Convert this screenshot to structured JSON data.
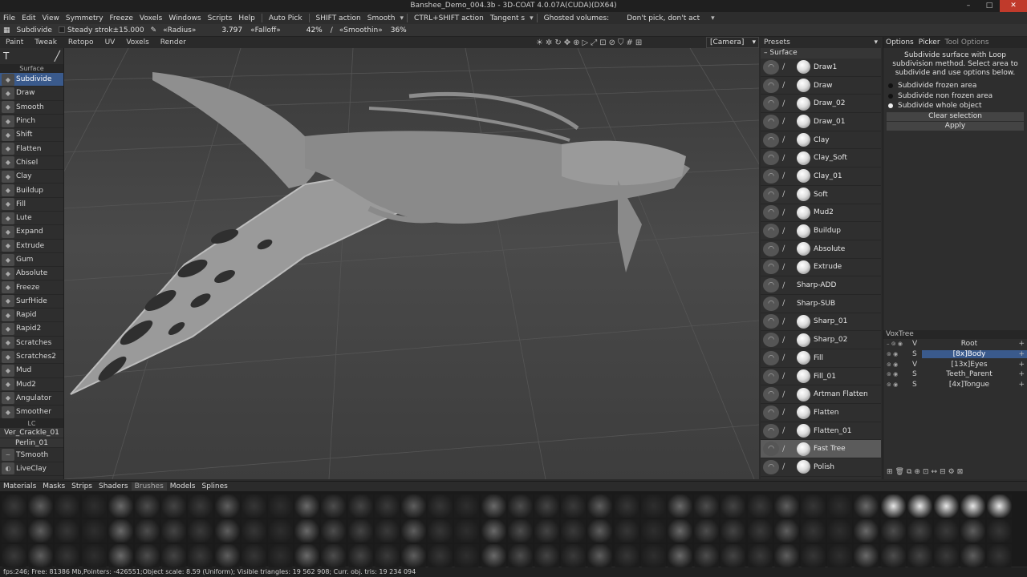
{
  "window": {
    "title": "Banshee_Demo_004.3b - 3D-COAT 4.0.07A(CUDA)(DX64)",
    "buttons": [
      "–",
      "□",
      "✕"
    ]
  },
  "menubar": {
    "items": [
      "File",
      "Edit",
      "View",
      "Symmetry",
      "Freeze",
      "Voxels",
      "Windows",
      "Scripts",
      "Help"
    ],
    "auto_pick": "Auto Pick",
    "shift_action_label": "SHIFT action",
    "shift_action_value": "Smooth",
    "ctrl_shift_label": "CTRL+SHIFT action",
    "ctrl_shift_value": "Tangent s",
    "ghosted_label": "Ghosted volumes:",
    "ghosted_value": "Don't pick, don't act"
  },
  "toolbar": {
    "tool_name": "Subdivide",
    "steady_stroke": "Steady strok±15.000",
    "radius_label": "«Radius»",
    "radius_value": "3.797",
    "falloff_label": "«Falloff»",
    "falloff_value": "42%",
    "smoothing_label": "«Smoothin»",
    "smoothing_value": "36%"
  },
  "rooms": [
    "Paint",
    "Tweak",
    "Retopo",
    "UV",
    "Voxels",
    "Render"
  ],
  "viewport": {
    "camera": "[Camera]"
  },
  "left_panel": {
    "header_icon": "T",
    "section": "Surface",
    "selected": "Subdivide",
    "tools": [
      "Subdivide",
      "Draw",
      "Smooth",
      "Pinch",
      "Shift",
      "Flatten",
      "Chisel",
      "Clay",
      "Buildup",
      "Fill",
      "Lute",
      "Expand",
      "Extrude",
      "Gum",
      "Absolute",
      "Freeze",
      "SurfHide",
      "Rapid",
      "Rapid2",
      "Scratches",
      "Scratches2",
      "Mud",
      "Mud2",
      "Angulator",
      "Smoother"
    ],
    "lc_label": "LC",
    "named": [
      "Ver_Crackle_01",
      "Perlin_01"
    ],
    "extra_tools": [
      "TSmooth",
      "LiveClay"
    ]
  },
  "presets_panel": {
    "tab": "Presets",
    "section": "Surface",
    "highlighted": "Fast Tree",
    "brushes": [
      "Draw1",
      "Draw",
      "Draw_02",
      "Draw_01",
      "Clay",
      "Clay_Soft",
      "Clay_01",
      "Soft",
      "Mud2",
      "Buildup",
      "Absolute",
      "Extrude",
      "Sharp-ADD",
      "Sharp-SUB",
      "Sharp_01",
      "Sharp_02",
      "Fill",
      "Fill_01",
      "Artman Flatten",
      "Flatten",
      "Flatten_01",
      "Fast Tree",
      "Polish"
    ]
  },
  "options_panel": {
    "tabs": [
      "Options",
      "Picker",
      "Tool Options"
    ],
    "description": "Subdivide surface with Loop subdivision method. Select area to subdivide and use options below.",
    "radios": [
      "Subdivide frozen area",
      "Subdivide non frozen area",
      "Subdivide whole object"
    ],
    "radio_selected": "Subdivide whole object",
    "clear_selection": "Clear selection",
    "apply": "Apply"
  },
  "voxtree": {
    "title": "VoxTree",
    "rows": [
      {
        "type": "V",
        "name": "Root"
      },
      {
        "type": "S",
        "name": "[8x]Body"
      },
      {
        "type": "V",
        "name": "[13x]Eyes"
      },
      {
        "type": "S",
        "name": "Teeth_Parent"
      },
      {
        "type": "S",
        "name": "[4x]Tongue"
      }
    ],
    "selected": "[8x]Body"
  },
  "library_tabs": [
    "Materials",
    "Masks",
    "Strips",
    "Shaders",
    "Brushes",
    "Models",
    "Splines"
  ],
  "library_active": "Brushes",
  "statusbar": "fps:246;   Free: 81386 Mb,Pointers: -426551;Object scale: 8.59 (Uniform); Visible triangles: 19 562 908; Curr. obj. tris: 19 234 094"
}
